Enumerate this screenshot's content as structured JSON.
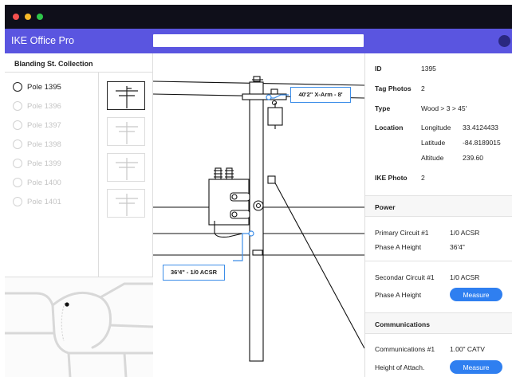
{
  "window": {
    "app_title": "IKE Office Pro",
    "search_value": ""
  },
  "collection": {
    "title": "Blanding St. Collection",
    "poles": [
      {
        "label": "Pole 1395",
        "selected": true
      },
      {
        "label": "Pole 1396",
        "selected": false
      },
      {
        "label": "Pole 1397",
        "selected": false
      },
      {
        "label": "Pole 1398",
        "selected": false
      },
      {
        "label": "Pole 1399",
        "selected": false
      },
      {
        "label": "Pole 1400",
        "selected": false
      },
      {
        "label": "Pole 1401",
        "selected": false
      }
    ]
  },
  "drawing": {
    "crossarm_callout": "40'2\" X-Arm - 8'",
    "secondary_callout": "36'4\" - 1/0 ACSR"
  },
  "details": {
    "id_label": "ID",
    "id_value": "1395",
    "tag_photos_label": "Tag Photos",
    "tag_photos_value": "2",
    "type_label": "Type",
    "type_value": "Wood > 3 > 45'",
    "location_label": "Location",
    "longitude_label": "Longitude",
    "longitude_value": "33.4124433",
    "latitude_label": "Latitude",
    "latitude_value": "-84.8189015",
    "altitude_label": "Altitude",
    "altitude_value": "239.60",
    "ike_photo_label": "IKE Photo",
    "ike_photo_value": "2"
  },
  "power": {
    "heading": "Power",
    "primary_circuit_label": "Primary Circuit #1",
    "primary_circuit_value": "1/0 ACSR",
    "phase_a_height_label": "Phase A Height",
    "phase_a_height_value": "36'4\"",
    "secondary_circuit_label": "Secondar Circuit #1",
    "secondary_circuit_value": "1/0 ACSR",
    "secondary_phase_label": "Phase A Height",
    "measure_label": "Measure"
  },
  "communications": {
    "heading": "Communications",
    "circuit_label": "Communications #1",
    "circuit_value": "1.00\" CATV",
    "attach_label": "Height of Attach.",
    "measure_label": "Measure"
  },
  "colors": {
    "chrome": "#0f0f1a",
    "app_bar": "#5a55e0",
    "accent": "#2f7ff0",
    "callout_border": "#3d8ee8"
  }
}
